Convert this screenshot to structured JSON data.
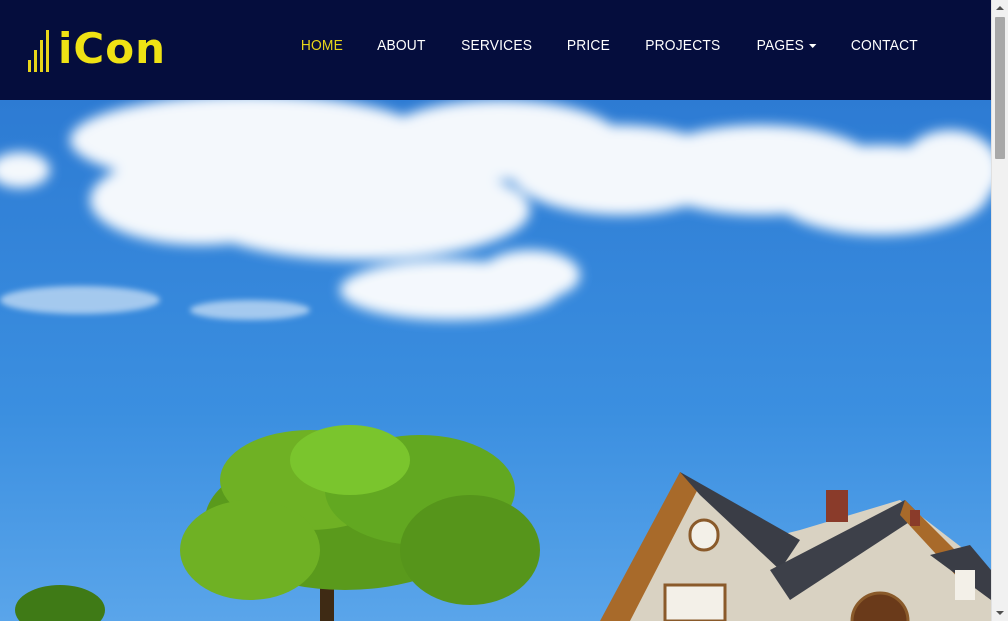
{
  "brand": {
    "name": "iCon",
    "accent": "#e8d51a",
    "nav_bg": "#050d3d"
  },
  "nav": {
    "items": [
      {
        "label": "HOME",
        "active": true
      },
      {
        "label": "ABOUT"
      },
      {
        "label": "SERVICES"
      },
      {
        "label": "PRICE"
      },
      {
        "label": "PROJECTS"
      },
      {
        "label": "PAGES",
        "dropdown": true
      },
      {
        "label": "CONTACT"
      }
    ]
  },
  "hero": {
    "image": "hero-house-tree-sky"
  }
}
